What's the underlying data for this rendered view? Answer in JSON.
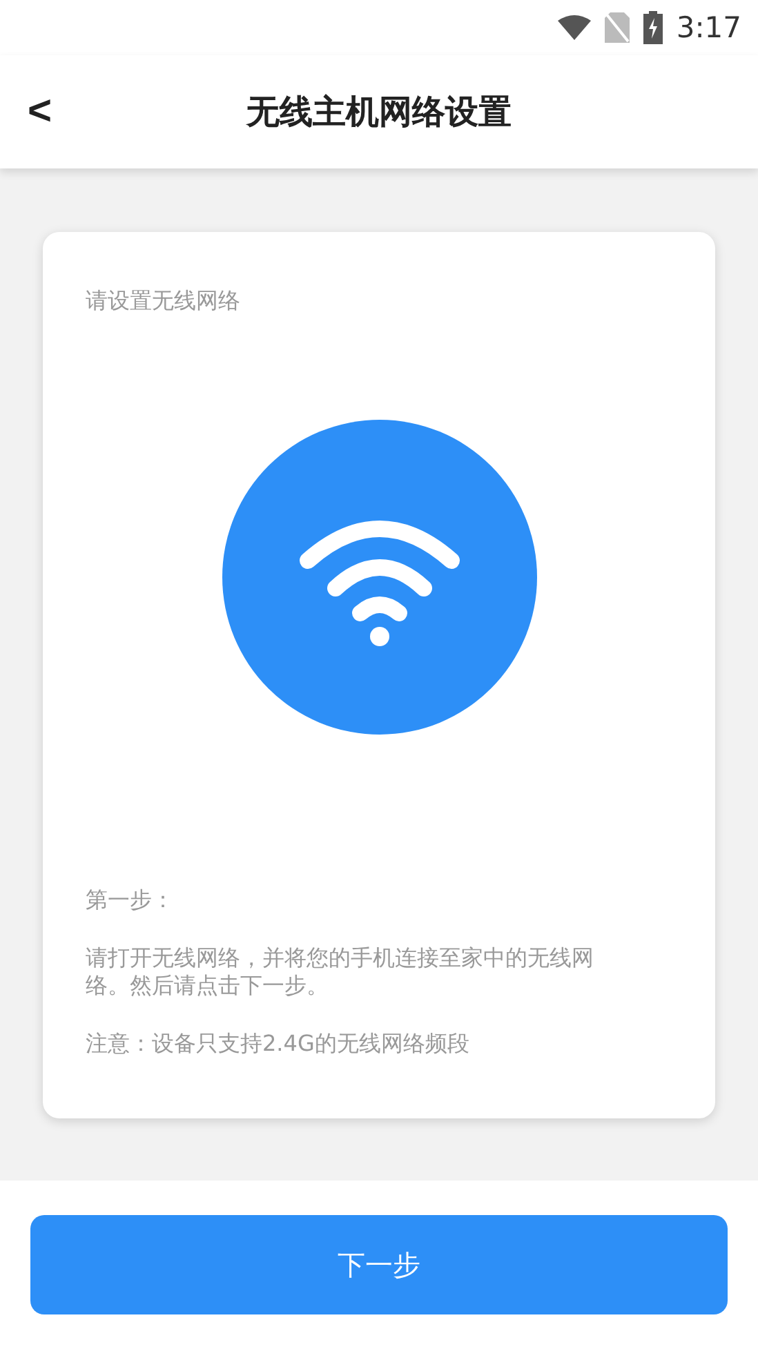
{
  "status_bar": {
    "time": "3:17"
  },
  "header": {
    "back": "<",
    "title": "无线主机网络设置"
  },
  "card": {
    "heading": "请设置无线网络",
    "step_title": "第一步：",
    "step_text": "请打开无线网络，并将您的手机连接至家中的无线网络。然后请点击下一步。",
    "note": "注意：设备只支持2.4G的无线网络频段"
  },
  "next_button": "下一步"
}
